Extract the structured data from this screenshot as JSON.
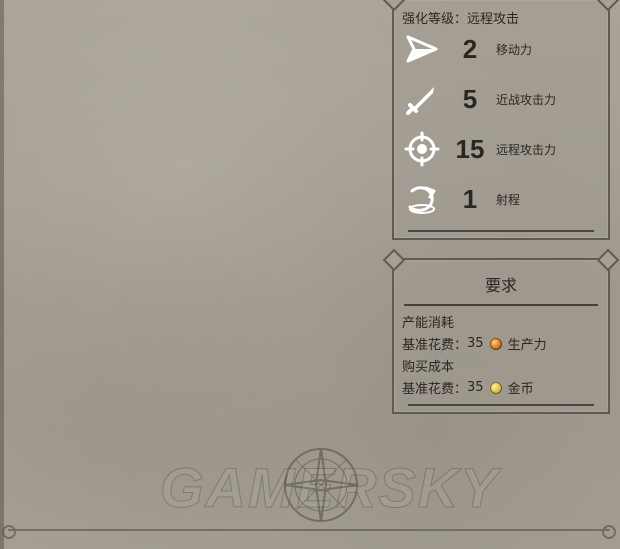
{
  "stats": {
    "strengthen_label": "强化等级：远程攻击",
    "rows": [
      {
        "icon": "move-arrow-icon",
        "value": "2",
        "label": "移动力"
      },
      {
        "icon": "sword-icon",
        "value": "5",
        "label": "近战攻击力"
      },
      {
        "icon": "crosshair-icon",
        "value": "15",
        "label": "远程攻击力"
      },
      {
        "icon": "range-arc-icon",
        "value": "1",
        "label": "射程"
      }
    ]
  },
  "requirements": {
    "title": "要求",
    "production": {
      "heading": "产能消耗",
      "base_label": "基准花费：",
      "amount": "35",
      "unit": "生产力"
    },
    "purchase": {
      "heading": "购买成本",
      "base_label": "基准花费：",
      "amount": "35",
      "unit": "金币"
    }
  },
  "watermark": {
    "text": "GAMERSKY"
  },
  "colors": {
    "panel_border": "#5e5a54",
    "text": "#2a2723",
    "background": "#a7a096"
  }
}
